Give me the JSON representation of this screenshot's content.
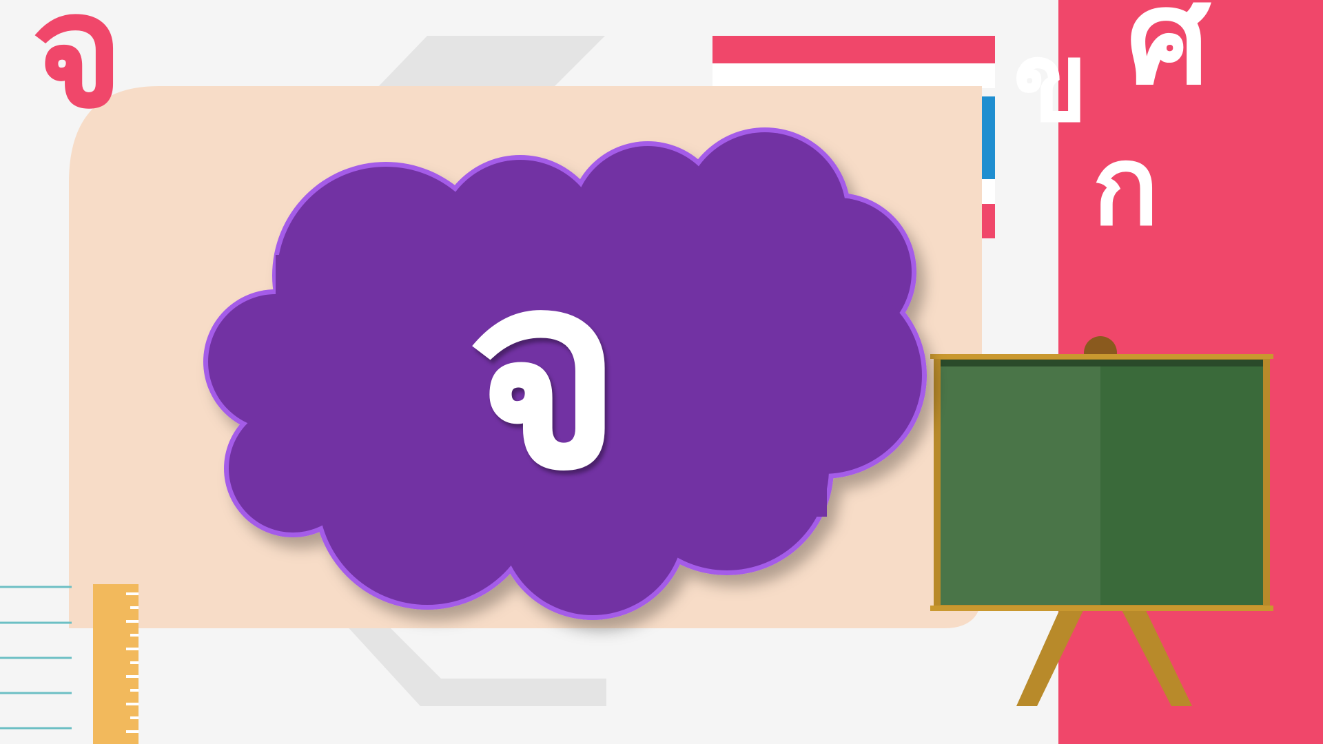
{
  "colors": {
    "background": "#f5f5f5",
    "accent_pink": "#f0476a",
    "card_peach": "#f7dcc7",
    "cloud_purple": "#7232a3",
    "cloud_glow": "#a45be8",
    "board_green": "#3f6b40",
    "board_frame": "#b88a2a",
    "ruler_orange": "#f2b95c",
    "notebook_line": "#6cbfc4",
    "flag_blue": "#1f8ed0"
  },
  "decor": {
    "corner_letter": "จ",
    "pink_panel_letters": [
      "ข",
      "ศ",
      "ก"
    ]
  },
  "main": {
    "featured_letter": "จ"
  },
  "icons": {
    "cloud": "cloud-shape",
    "chalkboard": "chalkboard-easel-icon",
    "ruler": "ruler-icon",
    "notebook": "notebook-lines-icon",
    "flag": "thai-flag-stripes-icon"
  }
}
